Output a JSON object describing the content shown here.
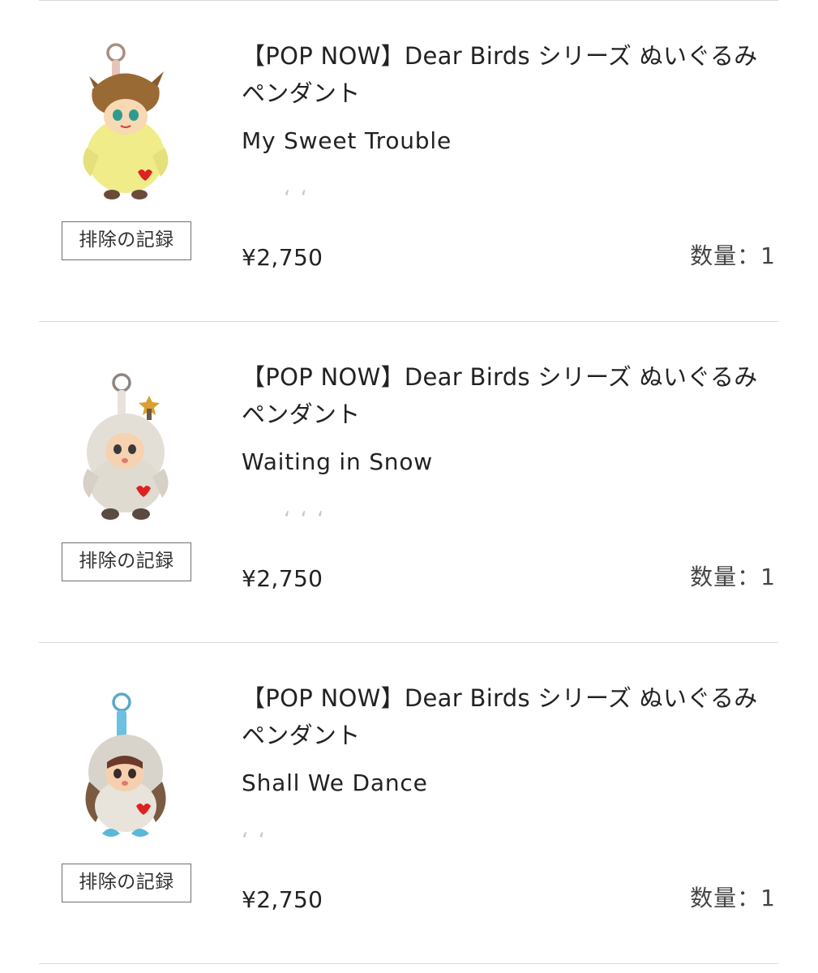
{
  "cart": {
    "exclude_label": "排除の記録",
    "items": [
      {
        "title": "【POP NOW】Dear Birds シリーズ ぬいぐるみペンダント",
        "variant": "My Sweet Trouble",
        "price": "¥2,750",
        "quantity_label": "数量：1"
      },
      {
        "title": "【POP NOW】Dear Birds シリーズ ぬいぐるみペンダント",
        "variant": "Waiting in Snow",
        "price": "¥2,750",
        "quantity_label": "数量：1"
      },
      {
        "title": "【POP NOW】Dear Birds シリーズ ぬいぐるみペンダント",
        "variant": "Shall We Dance",
        "price": "¥2,750",
        "quantity_label": "数量：1"
      }
    ]
  },
  "colors": {
    "divider": "#d9d9d9",
    "text": "#222222",
    "button_border": "#6f6f6f"
  }
}
